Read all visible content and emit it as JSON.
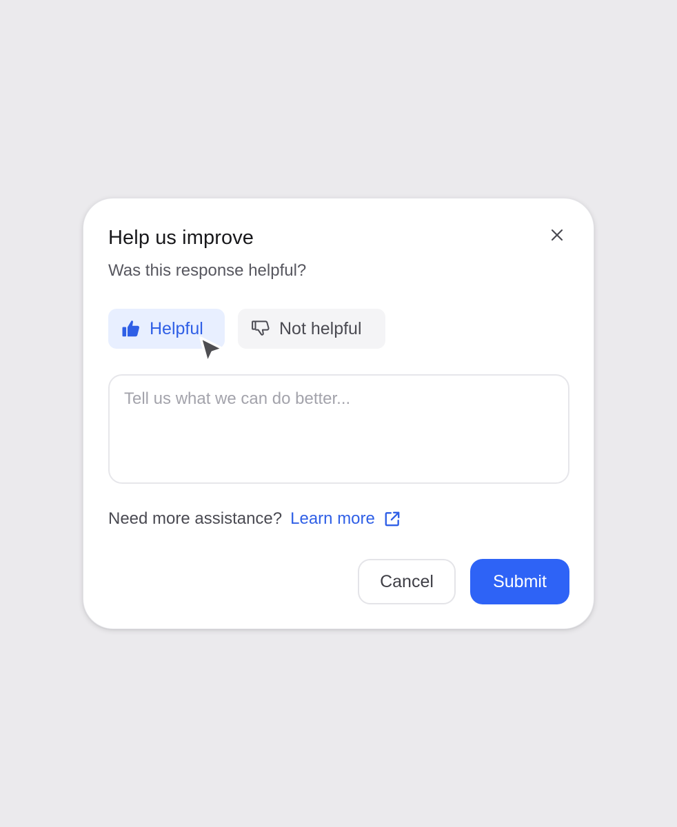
{
  "dialog": {
    "title": "Help us improve",
    "subtitle": "Was this response helpful?",
    "close_icon": "close-icon"
  },
  "choices": {
    "selected": "helpful",
    "helpful": {
      "label": "Helpful",
      "icon": "thumbs-up-icon"
    },
    "not_helpful": {
      "label": "Not helpful",
      "icon": "thumbs-down-icon"
    }
  },
  "feedback": {
    "value": "",
    "placeholder": "Tell us what we can do better..."
  },
  "assistance": {
    "label": "Need more assistance?",
    "link_label": "Learn more",
    "link_icon": "external-link-icon"
  },
  "actions": {
    "cancel_label": "Cancel",
    "submit_label": "Submit"
  },
  "colors": {
    "accent": "#2e63f6",
    "selected_bg": "#e8efff",
    "background": "#ebeaed"
  }
}
